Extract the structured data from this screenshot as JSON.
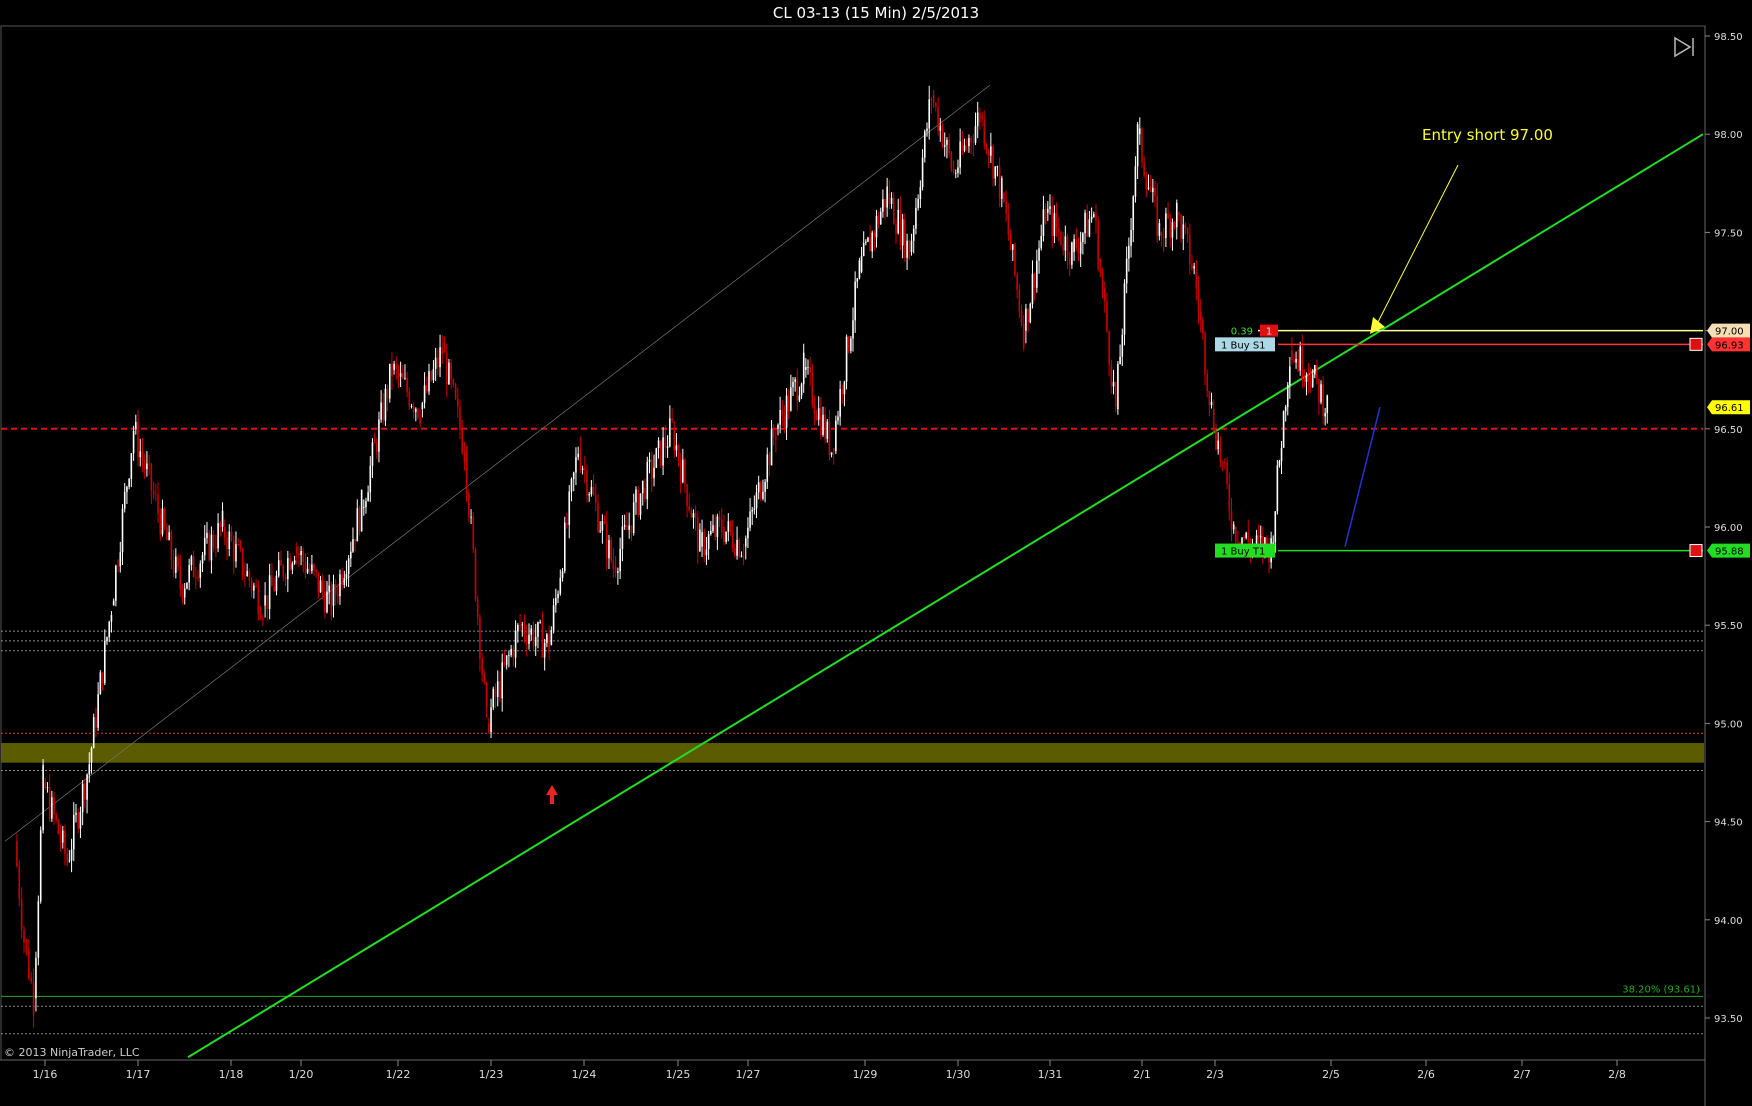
{
  "window": {
    "title": "CL 03-13 (15 Min)  2/5/2013"
  },
  "copyright": "© 2013 NinjaTrader, LLC",
  "icons": {
    "go_to_end": "go-to-end-icon"
  },
  "colors": {
    "background": "#000000",
    "candle_up": "#ffffff",
    "candle_down": "#cc0000",
    "trendline": "#22dd22",
    "support_line": "#dd1111",
    "fib_zone": "#6b6b00",
    "annotation": "#ffff33"
  },
  "chart_data": {
    "type": "candlestick",
    "title": "CL 03-13 (15 Min)  2/5/2013",
    "y_axis": {
      "ylim": [
        93.3,
        98.55
      ],
      "ticks": [
        "98.50",
        "98.00",
        "97.50",
        "97.00",
        "96.50",
        "96.00",
        "95.50",
        "95.00",
        "94.50",
        "94.00",
        "93.50"
      ],
      "side": "right"
    },
    "x_axis": {
      "ticks": [
        "1/16",
        "1/17",
        "1/18",
        "1/20",
        "1/22",
        "1/23",
        "1/24",
        "1/25",
        "1/27",
        "1/29",
        "1/30",
        "1/31",
        "2/1",
        "2/3",
        "2/5",
        "2/6",
        "2/7",
        "2/8"
      ]
    },
    "price_path": [
      {
        "date": "1/16",
        "price": 94.4
      },
      {
        "date": "1/16",
        "price": 93.9
      },
      {
        "date": "1/16",
        "price": 93.6
      },
      {
        "date": "1/16",
        "price": 94.7
      },
      {
        "date": "1/17",
        "price": 94.3
      },
      {
        "date": "1/17",
        "price": 94.8
      },
      {
        "date": "1/17",
        "price": 95.6
      },
      {
        "date": "1/17",
        "price": 96.5
      },
      {
        "date": "1/18",
        "price": 95.7
      },
      {
        "date": "1/18",
        "price": 96.0
      },
      {
        "date": "1/20",
        "price": 95.6
      },
      {
        "date": "1/20",
        "price": 95.9
      },
      {
        "date": "1/22",
        "price": 95.6
      },
      {
        "date": "1/22",
        "price": 96.1
      },
      {
        "date": "1/22",
        "price": 96.8
      },
      {
        "date": "1/23",
        "price": 96.6
      },
      {
        "date": "1/23",
        "price": 96.9
      },
      {
        "date": "1/23",
        "price": 96.4
      },
      {
        "date": "1/23",
        "price": 95.0
      },
      {
        "date": "1/24",
        "price": 95.5
      },
      {
        "date": "1/24",
        "price": 95.4
      },
      {
        "date": "1/24",
        "price": 96.4
      },
      {
        "date": "1/25",
        "price": 95.8
      },
      {
        "date": "1/25",
        "price": 96.2
      },
      {
        "date": "1/25",
        "price": 96.5
      },
      {
        "date": "1/27",
        "price": 95.9
      },
      {
        "date": "1/27",
        "price": 96.0
      },
      {
        "date": "1/27",
        "price": 95.9
      },
      {
        "date": "1/29",
        "price": 96.5
      },
      {
        "date": "1/29",
        "price": 96.8
      },
      {
        "date": "1/29",
        "price": 96.4
      },
      {
        "date": "1/29",
        "price": 97.3
      },
      {
        "date": "1/30",
        "price": 97.7
      },
      {
        "date": "1/30",
        "price": 97.4
      },
      {
        "date": "1/30",
        "price": 98.2
      },
      {
        "date": "1/30",
        "price": 97.8
      },
      {
        "date": "1/31",
        "price": 98.1
      },
      {
        "date": "1/31",
        "price": 97.7
      },
      {
        "date": "1/31",
        "price": 97.0
      },
      {
        "date": "1/31",
        "price": 97.6
      },
      {
        "date": "2/1",
        "price": 97.4
      },
      {
        "date": "2/1",
        "price": 97.6
      },
      {
        "date": "2/1",
        "price": 96.6
      },
      {
        "date": "2/1",
        "price": 98.0
      },
      {
        "date": "2/3",
        "price": 97.5
      },
      {
        "date": "2/3",
        "price": 97.6
      },
      {
        "date": "2/3",
        "price": 97.3
      },
      {
        "date": "2/3",
        "price": 96.6
      },
      {
        "date": "2/5",
        "price": 96.0
      },
      {
        "date": "2/5",
        "price": 95.9
      },
      {
        "date": "2/5",
        "price": 95.9
      },
      {
        "date": "2/5",
        "price": 96.9
      },
      {
        "date": "2/5",
        "price": 96.8
      },
      {
        "date": "2/5",
        "price": 96.61
      }
    ],
    "horizontal_levels": [
      {
        "price": 96.5,
        "style": "dashed",
        "color": "#dd1111"
      },
      {
        "price": 95.47,
        "style": "dotted",
        "color": "#888888"
      },
      {
        "price": 95.42,
        "style": "dotted",
        "color": "#888888"
      },
      {
        "price": 95.37,
        "style": "dotted",
        "color": "#888888"
      },
      {
        "price": 94.76,
        "style": "dotted",
        "color": "#888888"
      },
      {
        "price": 93.56,
        "style": "dotted",
        "color": "#888888"
      },
      {
        "price": 93.42,
        "style": "dotted",
        "color": "#888888"
      }
    ],
    "zone": {
      "from": 94.8,
      "to": 94.9,
      "color": "#6b6b00"
    },
    "fib_level": {
      "price": 93.61,
      "label": "38.20% (93.61)",
      "color": "#22aa22"
    },
    "trendline_green": {
      "from": {
        "date": "1/17",
        "price": 93.3
      },
      "to": {
        "date": "2/8",
        "price": 98.0
      }
    },
    "orders": [
      {
        "label": "1  Buy S1",
        "price": 96.93,
        "color": "#ff3333",
        "tag_color": "#add8e6"
      },
      {
        "label": "1  Buy T1",
        "price": 95.88,
        "color": "#22dd22",
        "tag_color": "#22dd22"
      },
      {
        "label": "0.39",
        "marker": "1",
        "price": 97.0,
        "color": "#ffff99"
      }
    ],
    "price_markers": [
      {
        "value": "97.00",
        "bg": "#f5deb3"
      },
      {
        "value": "96.93",
        "bg": "#ff3333"
      },
      {
        "value": "96.61",
        "bg": "#ffff00"
      },
      {
        "value": "95.88",
        "bg": "#22dd22"
      }
    ],
    "annotation": {
      "text": "Entry short 97.00",
      "color": "#ffff33"
    }
  }
}
